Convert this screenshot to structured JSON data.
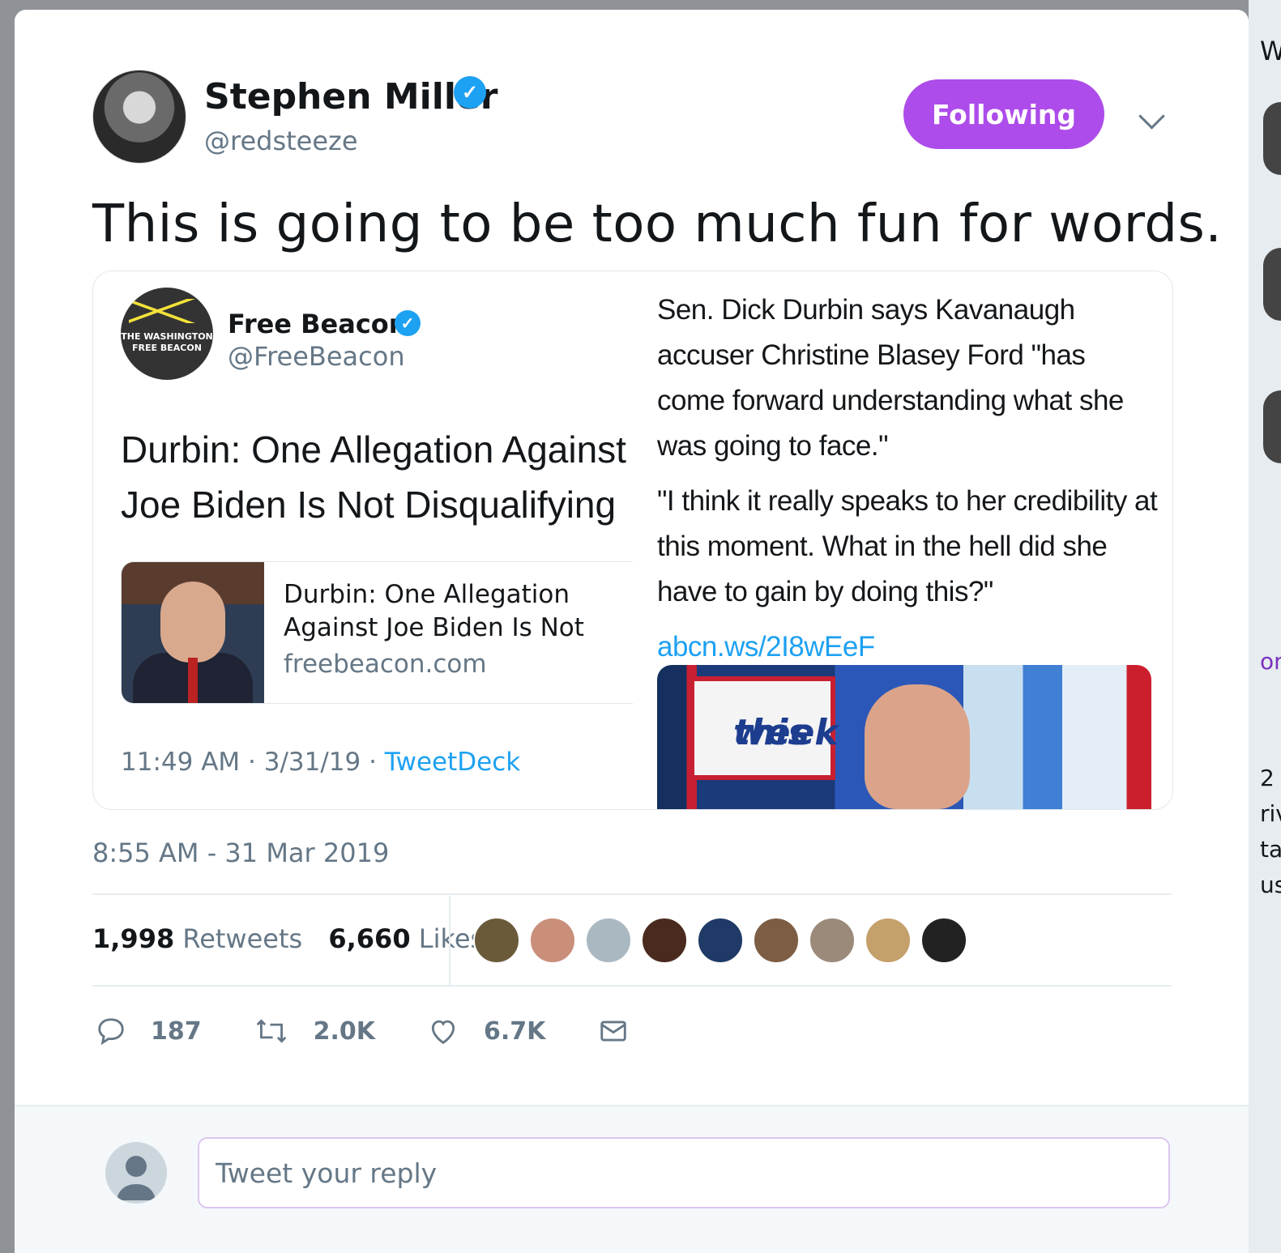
{
  "background_fragments": [
    "W",
    "on",
    "2",
    "riv",
    "tat",
    "us"
  ],
  "tweet": {
    "author_name": "Stephen Miller",
    "author_handle": "@redsteeze",
    "follow_label": "Following",
    "text": "This is going to be too much fun for words.",
    "timestamp": "8:55 AM - 31 Mar 2019",
    "retweets_count": "1,998",
    "retweets_label": "Retweets",
    "likes_count": "6,660",
    "likes_label": "Likes",
    "liker_avatar_count": 9
  },
  "quoted": {
    "logo_text_line1": "THE WASHINGTON",
    "logo_text_line2": "FREE BEACON",
    "name": "Free Beacon",
    "handle": "@FreeBeacon",
    "headline": "Durbin: One Allegation Against Joe Biden Is Not Disqualifying",
    "card_title": "Durbin: One Allegation Against Joe Biden Is Not Disqualifying",
    "card_domain": "freebeacon.com",
    "time": "11:49 AM",
    "date": "3/31/19",
    "source": "TweetDeck",
    "quote_p1": "Sen. Dick Durbin says Kavanaugh accuser Christine Blasey Ford \"has come forward understanding what she was going to face.\"",
    "quote_p2": "\"I think it really speaks to her credibility at this moment. What in the hell did she have to gain by doing this?\"",
    "quote_link": "abcn.ws/2I8wEeF",
    "video_logo_line1": "this",
    "video_logo_line2": "week"
  },
  "actions": {
    "replies": "187",
    "retweets": "2.0K",
    "likes": "6.7K"
  },
  "reply": {
    "placeholder": "Tweet your reply"
  },
  "colors": {
    "follow_button": "#ad4cea",
    "link": "#1da1f2",
    "muted": "#657786",
    "verified": "#1da1f2"
  },
  "icons": {
    "reply": "speech-bubble",
    "retweet": "retweet-arrows",
    "like": "heart-outline",
    "dm": "envelope"
  }
}
